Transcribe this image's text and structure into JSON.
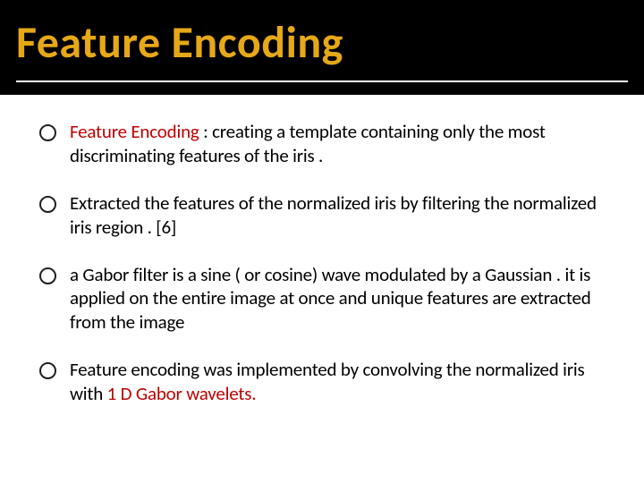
{
  "slide": {
    "title": "Feature  Encoding",
    "bullets": [
      {
        "accent_prefix": " Feature Encoding",
        "rest": " :  creating a template containing only the most discriminating features of the iris ."
      },
      {
        "accent_prefix": "",
        "rest": "Extracted the features of the normalized iris by filtering the normalized iris region . [6]"
      },
      {
        "accent_prefix": "",
        "rest": " a Gabor filter is a sine ( or cosine) wave modulated by a Gaussian .  it is applied on the entire image at once and unique features are extracted from the image"
      },
      {
        "accent_prefix": "",
        "rest_before": "Feature encoding was implemented by convolving the normalized iris with ",
        "accent_mid": " 1 D  Gabor wavelets.",
        "rest": ""
      }
    ]
  },
  "colors": {
    "title": "#e6a817",
    "accent": "#c00000",
    "header_bg": "#000000",
    "body_text": "#000000"
  }
}
